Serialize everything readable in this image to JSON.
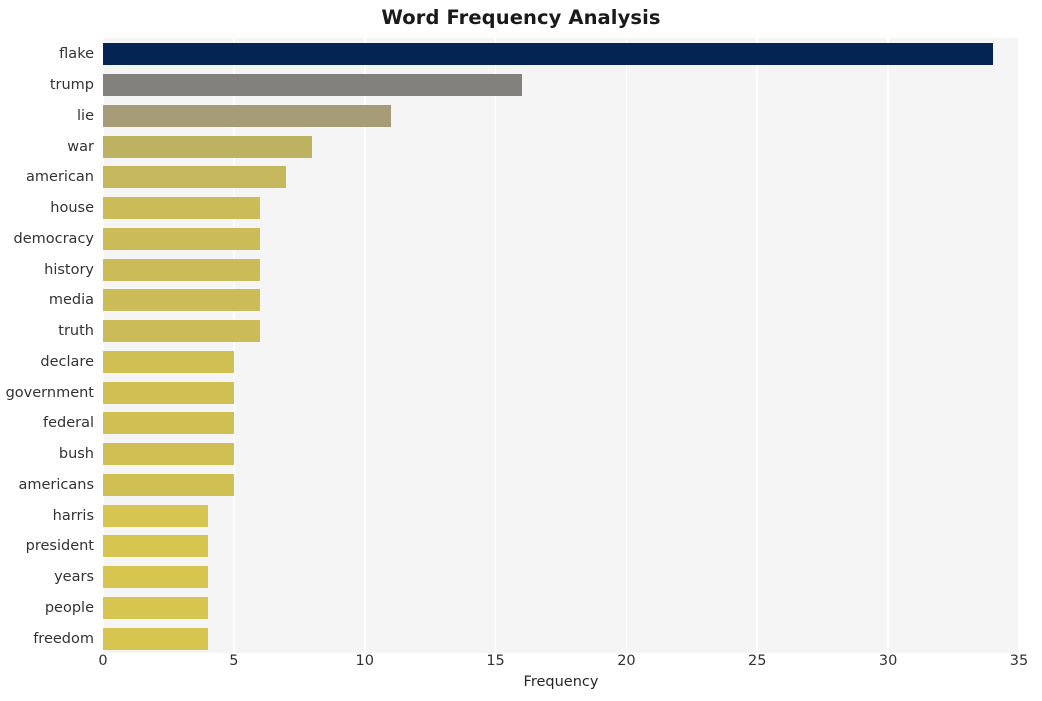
{
  "chart_data": {
    "type": "bar",
    "orientation": "horizontal",
    "title": "Word Frequency Analysis",
    "xlabel": "Frequency",
    "ylabel": "",
    "categories": [
      "flake",
      "trump",
      "lie",
      "war",
      "american",
      "house",
      "democracy",
      "history",
      "media",
      "truth",
      "declare",
      "government",
      "federal",
      "bush",
      "americans",
      "harris",
      "president",
      "years",
      "people",
      "freedom"
    ],
    "values": [
      34,
      16,
      11,
      8,
      7,
      6,
      6,
      6,
      6,
      6,
      5,
      5,
      5,
      5,
      5,
      4,
      4,
      4,
      4,
      4
    ],
    "bar_colors": [
      "#042453",
      "#83817c",
      "#a69c77",
      "#bdb162",
      "#c5b75c",
      "#cbbc57",
      "#cbbc57",
      "#cbbc57",
      "#cbbc57",
      "#cbbc57",
      "#d0c053",
      "#d0c053",
      "#d0c053",
      "#d0c053",
      "#d0c053",
      "#d6c550",
      "#d6c550",
      "#d6c550",
      "#d6c550",
      "#d6c550"
    ],
    "xlim": [
      0,
      35
    ],
    "x_ticks": [
      0,
      5,
      10,
      15,
      20,
      25,
      30,
      35
    ],
    "x_tick_labels": [
      "0",
      "5",
      "10",
      "15",
      "20",
      "25",
      "30",
      "35"
    ],
    "grid": "vertical-white-on-gray",
    "legend": null,
    "style": {
      "plot_background": "#f5f5f6",
      "figure_background": "#ffffff",
      "gridline_color": "#ffffff",
      "tick_label_color": "#333333",
      "title_color": "#1a1a1a"
    }
  }
}
